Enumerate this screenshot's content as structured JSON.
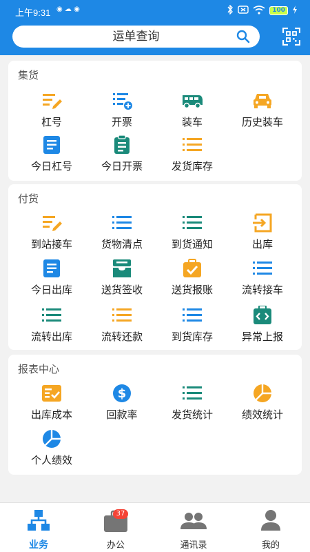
{
  "status_bar": {
    "time": "上午9:31",
    "notif_icons": "◉ ☁ ◉",
    "battery": "100"
  },
  "search": {
    "placeholder": "运单查询"
  },
  "colors": {
    "brand_blue": "#1e88e5",
    "orange": "#f5a623",
    "teal": "#1a8a7a",
    "badge_red": "#f44336"
  },
  "sections": [
    {
      "title": "集货",
      "items": [
        {
          "label": "杠号",
          "icon": "edit-list-icon"
        },
        {
          "label": "开票",
          "icon": "add-list-icon"
        },
        {
          "label": "装车",
          "icon": "van-icon"
        },
        {
          "label": "历史装车",
          "icon": "car-icon"
        },
        {
          "label": "今日杠号",
          "icon": "document-icon"
        },
        {
          "label": "今日开票",
          "icon": "clipboard-icon"
        },
        {
          "label": "发货库存",
          "icon": "list-icon"
        }
      ]
    },
    {
      "title": "付货",
      "items": [
        {
          "label": "到站接车",
          "icon": "edit-list-icon"
        },
        {
          "label": "货物清点",
          "icon": "list-icon"
        },
        {
          "label": "到货通知",
          "icon": "list-icon"
        },
        {
          "label": "出库",
          "icon": "exit-icon"
        },
        {
          "label": "今日出库",
          "icon": "document-icon"
        },
        {
          "label": "送货签收",
          "icon": "tray-icon"
        },
        {
          "label": "送货报账",
          "icon": "check-bag-icon"
        },
        {
          "label": "流转接车",
          "icon": "list-icon"
        },
        {
          "label": "流转出库",
          "icon": "list-icon"
        },
        {
          "label": "流转还款",
          "icon": "list-icon"
        },
        {
          "label": "到货库存",
          "icon": "list-icon"
        },
        {
          "label": "异常上报",
          "icon": "code-icon"
        }
      ]
    },
    {
      "title": "报表中心",
      "items": [
        {
          "label": "出库成本",
          "icon": "check-list-icon"
        },
        {
          "label": "回款率",
          "icon": "dollar-icon"
        },
        {
          "label": "发货统计",
          "icon": "list-icon"
        },
        {
          "label": "绩效统计",
          "icon": "pie-icon"
        },
        {
          "label": "个人绩效",
          "icon": "pie-icon"
        }
      ]
    }
  ],
  "tabs": [
    {
      "label": "业务",
      "icon": "org-chart-icon",
      "active": true
    },
    {
      "label": "办公",
      "icon": "briefcase-icon",
      "badge": "37"
    },
    {
      "label": "通讯录",
      "icon": "contacts-icon"
    },
    {
      "label": "我的",
      "icon": "person-icon"
    }
  ]
}
